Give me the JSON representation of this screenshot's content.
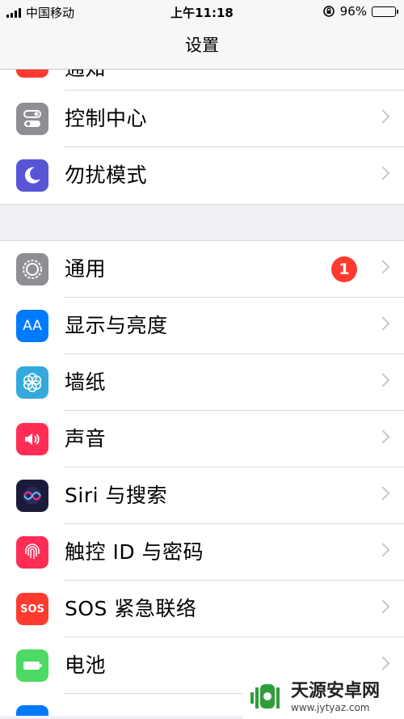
{
  "status_bar": {
    "carrier": "中国移动",
    "time": "上午11:18",
    "battery": "96%",
    "battery_level": 0.96
  },
  "nav": {
    "title": "设置"
  },
  "partial_item": {
    "label": "通知"
  },
  "group1": [
    {
      "label": "控制中心",
      "icon": "control-center-icon",
      "color": "#8e8e93"
    },
    {
      "label": "勿扰模式",
      "icon": "moon-icon",
      "color": "#5856d6"
    }
  ],
  "group2": [
    {
      "label": "通用",
      "icon": "gear-icon",
      "color": "#8e8e93",
      "badge": "1"
    },
    {
      "label": "显示与亮度",
      "icon": "display-aa-icon",
      "icon_text": "AA",
      "color": "#007aff"
    },
    {
      "label": "墙纸",
      "icon": "wallpaper-flower-icon",
      "color": "#34aadc"
    },
    {
      "label": "声音",
      "icon": "speaker-icon",
      "color": "#ff2d55"
    },
    {
      "label": "Siri 与搜索",
      "icon": "siri-icon",
      "color": "#1c1c3a"
    },
    {
      "label": "触控 ID 与密码",
      "icon": "fingerprint-icon",
      "color": "#ff2d55"
    },
    {
      "label": "SOS 紧急联络",
      "icon": "sos-icon",
      "icon_text": "SOS",
      "color": "#ff3b30"
    },
    {
      "label": "电池",
      "icon": "battery-icon",
      "color": "#4cd964"
    }
  ],
  "watermark": {
    "name": "天源安卓网",
    "url": "www.jytyaz.com"
  }
}
